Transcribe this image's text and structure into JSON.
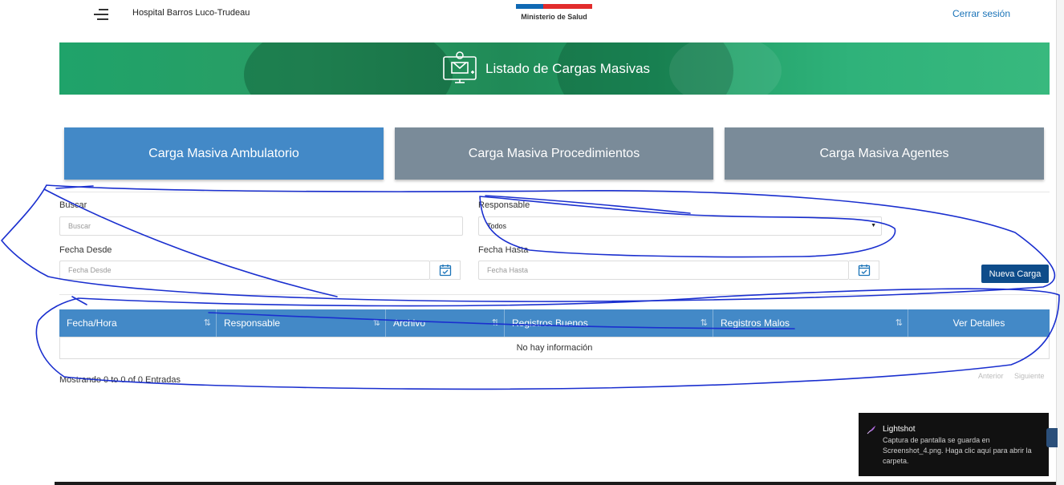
{
  "header": {
    "hospital_name": "Hospital Barros Luco-Trudeau",
    "ministry": "Ministerio de Salud",
    "logout": "Cerrar sesión"
  },
  "banner": {
    "title": "Listado de Cargas Masivas"
  },
  "tabs": [
    {
      "label": "Carga Masiva Ambulatorio",
      "active": true
    },
    {
      "label": "Carga Masiva Procedimientos",
      "active": false
    },
    {
      "label": "Carga Masiva Agentes",
      "active": false
    }
  ],
  "filters": {
    "buscar_label": "Buscar",
    "buscar_placeholder": "Buscar",
    "responsable_label": "Responsable",
    "responsable_value": "Todos",
    "fecha_desde_label": "Fecha Desde",
    "fecha_desde_placeholder": "Fecha Desde",
    "fecha_hasta_label": "Fecha Hasta",
    "fecha_hasta_placeholder": "Fecha Hasta"
  },
  "actions": {
    "nueva_carga": "Nueva Carga"
  },
  "table": {
    "columns": [
      "Fecha/Hora",
      "Responsable",
      "Archivo",
      "Registros Buenos",
      "Registros Malos",
      "Ver Detalles"
    ],
    "empty_message": "No hay información",
    "info": "Mostrando 0 to 0 of 0 Entradas",
    "prev": "Anterior",
    "next": "Siguiente"
  },
  "toast": {
    "title": "Lightshot",
    "message": "Captura de pantalla se guarda en Screenshot_4.png. Haga clic aquí para abrir la carpeta."
  },
  "colors": {
    "tab_active": "#4389c7",
    "tab_inactive": "#7a8b99",
    "banner_green": "#2a9d64",
    "primary_button": "#0e4c8a",
    "annotation_ink": "#1a2fcf"
  }
}
